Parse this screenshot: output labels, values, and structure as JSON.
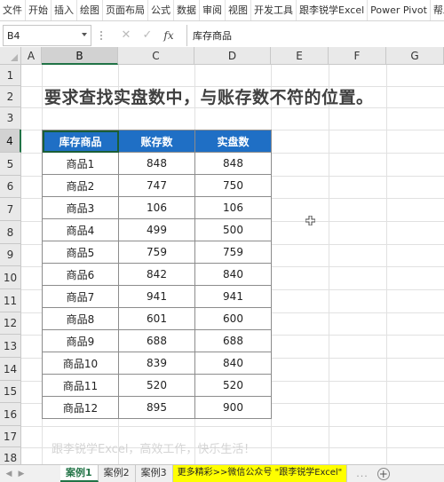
{
  "ribbon": {
    "tabs": [
      "文件",
      "开始",
      "插入",
      "绘图",
      "页面布局",
      "公式",
      "数据",
      "审阅",
      "视图",
      "开发工具",
      "跟李锐学Excel",
      "Power Pivot",
      "帮助"
    ]
  },
  "formula_bar": {
    "name_box": "B4",
    "fx_label": "fx",
    "content": "库存商品"
  },
  "columns": [
    "A",
    "B",
    "C",
    "D",
    "E",
    "F",
    "G"
  ],
  "rows": [
    "1",
    "2",
    "3",
    "4",
    "5",
    "6",
    "7",
    "8",
    "9",
    "10",
    "11",
    "12",
    "13",
    "14",
    "15",
    "16",
    "17",
    "18"
  ],
  "sheet": {
    "headline": "要求查找实盘数中，与账存数不符的位置。",
    "table": {
      "headers": [
        "库存商品",
        "账存数",
        "实盘数"
      ],
      "rows": [
        [
          "商品1",
          "848",
          "848"
        ],
        [
          "商品2",
          "747",
          "750"
        ],
        [
          "商品3",
          "106",
          "106"
        ],
        [
          "商品4",
          "499",
          "500"
        ],
        [
          "商品5",
          "759",
          "759"
        ],
        [
          "商品6",
          "842",
          "840"
        ],
        [
          "商品7",
          "941",
          "941"
        ],
        [
          "商品8",
          "601",
          "600"
        ],
        [
          "商品9",
          "688",
          "688"
        ],
        [
          "商品10",
          "839",
          "840"
        ],
        [
          "商品11",
          "520",
          "520"
        ],
        [
          "商品12",
          "895",
          "900"
        ]
      ]
    },
    "footer_note": "跟李锐学Excel，高效工作，快乐生活！"
  },
  "sheet_tabs": {
    "tabs": [
      "案例1",
      "案例2",
      "案例3"
    ],
    "promo": "更多精彩>>微信公众号 \"跟李锐学Excel\"",
    "add_label": "+",
    "more": "..."
  },
  "colors": {
    "header_fill": "#1f6fc5",
    "excel_green": "#217346",
    "promo_fill": "#ffff00"
  }
}
